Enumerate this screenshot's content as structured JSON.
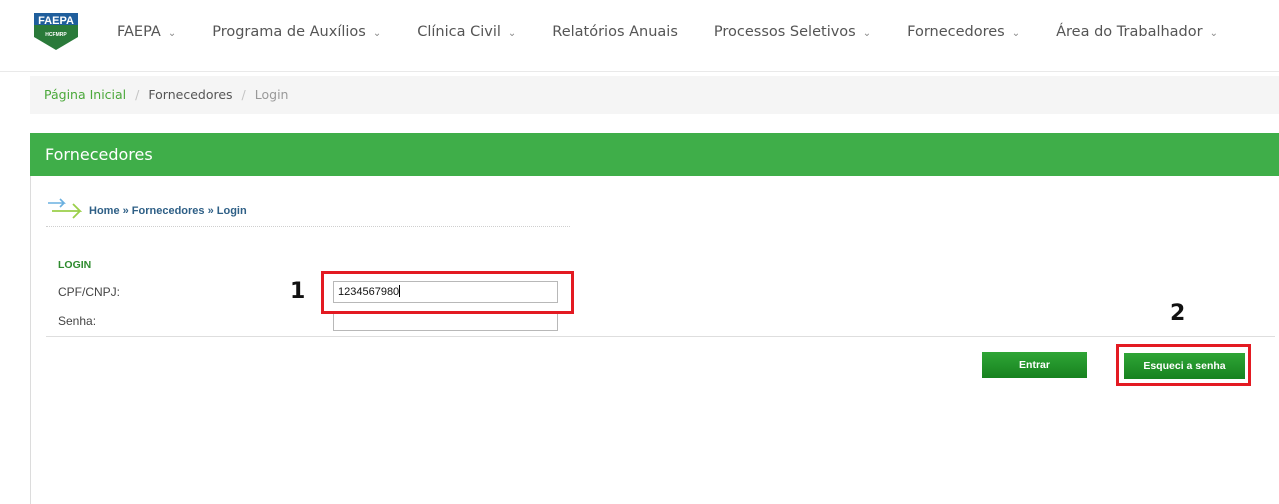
{
  "logo": {
    "text": "FAEPA",
    "subtext": "HCFMRP"
  },
  "nav": {
    "items": [
      {
        "label": "FAEPA",
        "has_dropdown": true
      },
      {
        "label": "Programa de Auxílios",
        "has_dropdown": true
      },
      {
        "label": "Clínica Civil",
        "has_dropdown": true
      },
      {
        "label": "Relatórios Anuais",
        "has_dropdown": false
      },
      {
        "label": "Processos Seletivos",
        "has_dropdown": true
      },
      {
        "label": "Fornecedores",
        "has_dropdown": true
      },
      {
        "label": "Área do Trabalhador",
        "has_dropdown": true
      }
    ],
    "chevron": "⌄"
  },
  "breadcrumb": {
    "home": "Página Inicial",
    "section": "Fornecedores",
    "current": "Login",
    "separator": "/"
  },
  "panel": {
    "title": "Fornecedores",
    "inner_breadcrumb": "Home » Fornecedores » Login"
  },
  "form": {
    "section_label": "LOGIN",
    "cpf_label": "CPF/CNPJ:",
    "cpf_value": "1234567980",
    "senha_label": "Senha:",
    "senha_value": "",
    "entrar_label": "Entrar",
    "esqueci_label": "Esqueci a senha"
  },
  "annotations": {
    "marker_1": "1",
    "marker_2": "2",
    "highlight_color": "#e31a22"
  },
  "colors": {
    "brand_green": "#3fae49",
    "link_green": "#4aa83a",
    "button_green": "#1e8f27"
  }
}
